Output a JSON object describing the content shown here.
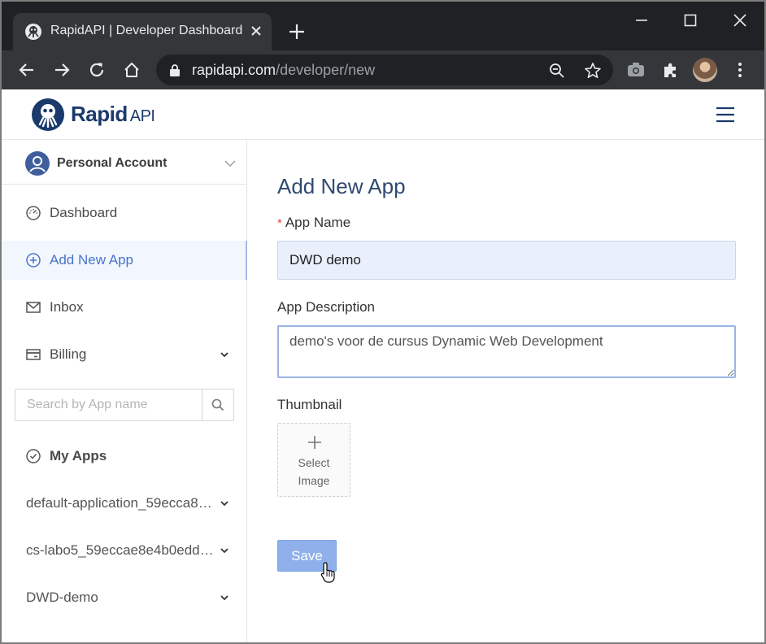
{
  "browser": {
    "tab_title": "RapidAPI | Developer Dashboard",
    "url_domain": "rapidapi.com",
    "url_path": "/developer/new"
  },
  "header": {
    "logo_text": "Rapid",
    "logo_suffix": "API"
  },
  "sidebar": {
    "account_label": "Personal Account",
    "nav": [
      {
        "label": "Dashboard",
        "icon": "dashboard-gauge-icon"
      },
      {
        "label": "Add New App",
        "icon": "plus-circle-icon",
        "active": true
      },
      {
        "label": "Inbox",
        "icon": "mail-icon"
      },
      {
        "label": "Billing",
        "icon": "credit-card-icon"
      }
    ],
    "search_placeholder": "Search by App name",
    "my_apps_label": "My Apps",
    "apps": [
      {
        "label": "default-application_59ecca87..."
      },
      {
        "label": "cs-labo5_59eccae8e4b0edd2..."
      },
      {
        "label": "DWD-demo"
      }
    ]
  },
  "form": {
    "title": "Add New App",
    "required_mark": "*",
    "app_name_label": "App Name",
    "app_name_value": "DWD demo",
    "description_label": "App Description",
    "description_value": "demo's voor de cursus Dynamic Web Development",
    "thumbnail_label": "Thumbnail",
    "select_image_line1": "Select",
    "select_image_line2": "Image",
    "save_label": "Save"
  },
  "colors": {
    "brand": "#1a3a6b",
    "accent": "#4a74c9",
    "save_button": "#8fb0ea",
    "input_fill": "#eaf0fb"
  }
}
